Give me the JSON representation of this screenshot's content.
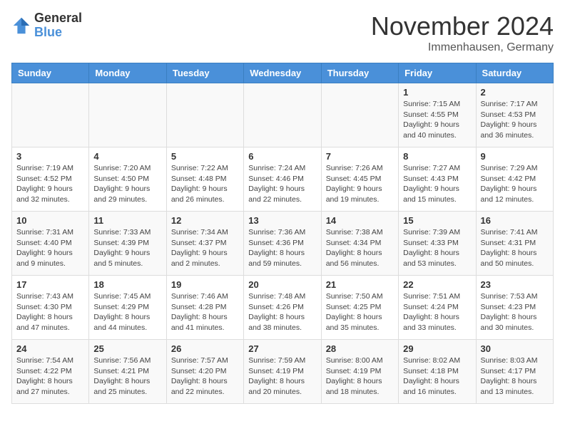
{
  "logo": {
    "general": "General",
    "blue": "Blue"
  },
  "title": "November 2024",
  "location": "Immenhausen, Germany",
  "days_of_week": [
    "Sunday",
    "Monday",
    "Tuesday",
    "Wednesday",
    "Thursday",
    "Friday",
    "Saturday"
  ],
  "weeks": [
    [
      {
        "day": "",
        "info": ""
      },
      {
        "day": "",
        "info": ""
      },
      {
        "day": "",
        "info": ""
      },
      {
        "day": "",
        "info": ""
      },
      {
        "day": "",
        "info": ""
      },
      {
        "day": "1",
        "info": "Sunrise: 7:15 AM\nSunset: 4:55 PM\nDaylight: 9 hours\nand 40 minutes."
      },
      {
        "day": "2",
        "info": "Sunrise: 7:17 AM\nSunset: 4:53 PM\nDaylight: 9 hours\nand 36 minutes."
      }
    ],
    [
      {
        "day": "3",
        "info": "Sunrise: 7:19 AM\nSunset: 4:52 PM\nDaylight: 9 hours\nand 32 minutes."
      },
      {
        "day": "4",
        "info": "Sunrise: 7:20 AM\nSunset: 4:50 PM\nDaylight: 9 hours\nand 29 minutes."
      },
      {
        "day": "5",
        "info": "Sunrise: 7:22 AM\nSunset: 4:48 PM\nDaylight: 9 hours\nand 26 minutes."
      },
      {
        "day": "6",
        "info": "Sunrise: 7:24 AM\nSunset: 4:46 PM\nDaylight: 9 hours\nand 22 minutes."
      },
      {
        "day": "7",
        "info": "Sunrise: 7:26 AM\nSunset: 4:45 PM\nDaylight: 9 hours\nand 19 minutes."
      },
      {
        "day": "8",
        "info": "Sunrise: 7:27 AM\nSunset: 4:43 PM\nDaylight: 9 hours\nand 15 minutes."
      },
      {
        "day": "9",
        "info": "Sunrise: 7:29 AM\nSunset: 4:42 PM\nDaylight: 9 hours\nand 12 minutes."
      }
    ],
    [
      {
        "day": "10",
        "info": "Sunrise: 7:31 AM\nSunset: 4:40 PM\nDaylight: 9 hours\nand 9 minutes."
      },
      {
        "day": "11",
        "info": "Sunrise: 7:33 AM\nSunset: 4:39 PM\nDaylight: 9 hours\nand 5 minutes."
      },
      {
        "day": "12",
        "info": "Sunrise: 7:34 AM\nSunset: 4:37 PM\nDaylight: 9 hours\nand 2 minutes."
      },
      {
        "day": "13",
        "info": "Sunrise: 7:36 AM\nSunset: 4:36 PM\nDaylight: 8 hours\nand 59 minutes."
      },
      {
        "day": "14",
        "info": "Sunrise: 7:38 AM\nSunset: 4:34 PM\nDaylight: 8 hours\nand 56 minutes."
      },
      {
        "day": "15",
        "info": "Sunrise: 7:39 AM\nSunset: 4:33 PM\nDaylight: 8 hours\nand 53 minutes."
      },
      {
        "day": "16",
        "info": "Sunrise: 7:41 AM\nSunset: 4:31 PM\nDaylight: 8 hours\nand 50 minutes."
      }
    ],
    [
      {
        "day": "17",
        "info": "Sunrise: 7:43 AM\nSunset: 4:30 PM\nDaylight: 8 hours\nand 47 minutes."
      },
      {
        "day": "18",
        "info": "Sunrise: 7:45 AM\nSunset: 4:29 PM\nDaylight: 8 hours\nand 44 minutes."
      },
      {
        "day": "19",
        "info": "Sunrise: 7:46 AM\nSunset: 4:28 PM\nDaylight: 8 hours\nand 41 minutes."
      },
      {
        "day": "20",
        "info": "Sunrise: 7:48 AM\nSunset: 4:26 PM\nDaylight: 8 hours\nand 38 minutes."
      },
      {
        "day": "21",
        "info": "Sunrise: 7:50 AM\nSunset: 4:25 PM\nDaylight: 8 hours\nand 35 minutes."
      },
      {
        "day": "22",
        "info": "Sunrise: 7:51 AM\nSunset: 4:24 PM\nDaylight: 8 hours\nand 33 minutes."
      },
      {
        "day": "23",
        "info": "Sunrise: 7:53 AM\nSunset: 4:23 PM\nDaylight: 8 hours\nand 30 minutes."
      }
    ],
    [
      {
        "day": "24",
        "info": "Sunrise: 7:54 AM\nSunset: 4:22 PM\nDaylight: 8 hours\nand 27 minutes."
      },
      {
        "day": "25",
        "info": "Sunrise: 7:56 AM\nSunset: 4:21 PM\nDaylight: 8 hours\nand 25 minutes."
      },
      {
        "day": "26",
        "info": "Sunrise: 7:57 AM\nSunset: 4:20 PM\nDaylight: 8 hours\nand 22 minutes."
      },
      {
        "day": "27",
        "info": "Sunrise: 7:59 AM\nSunset: 4:19 PM\nDaylight: 8 hours\nand 20 minutes."
      },
      {
        "day": "28",
        "info": "Sunrise: 8:00 AM\nSunset: 4:19 PM\nDaylight: 8 hours\nand 18 minutes."
      },
      {
        "day": "29",
        "info": "Sunrise: 8:02 AM\nSunset: 4:18 PM\nDaylight: 8 hours\nand 16 minutes."
      },
      {
        "day": "30",
        "info": "Sunrise: 8:03 AM\nSunset: 4:17 PM\nDaylight: 8 hours\nand 13 minutes."
      }
    ]
  ]
}
